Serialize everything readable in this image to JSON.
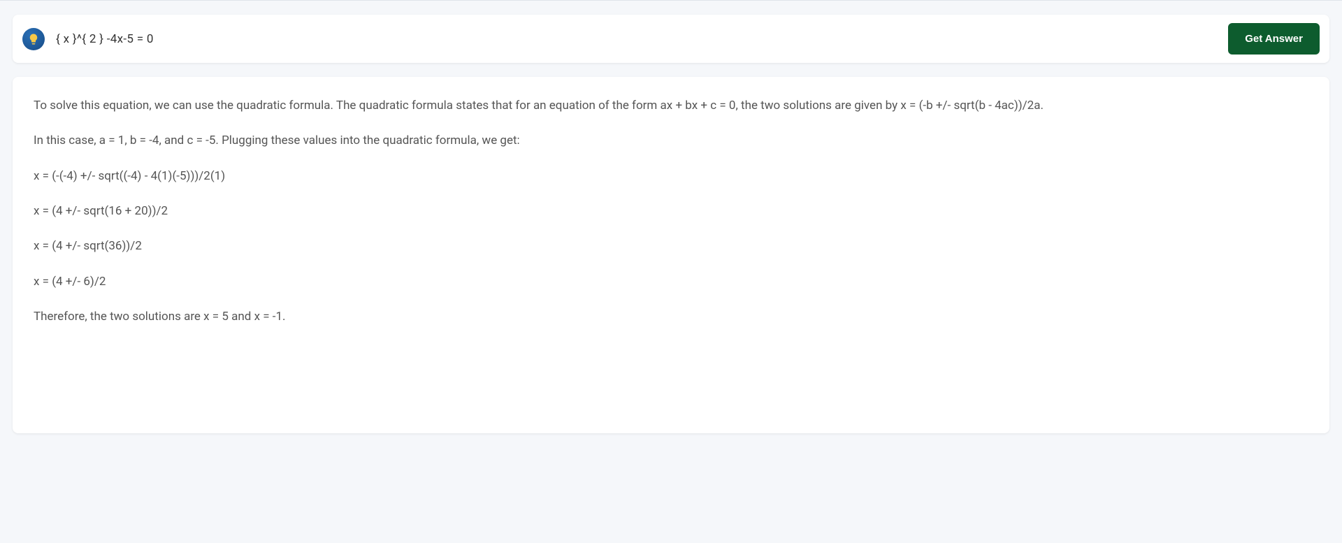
{
  "header": {
    "query": "{ x  }^{ 2  }  -4x-5 =  0",
    "button_label": "Get Answer"
  },
  "answer": {
    "lines": [
      "To solve this equation, we can use the quadratic formula. The quadratic formula states that for an equation of the form ax + bx + c = 0, the two solutions are given by x = (-b +/- sqrt(b - 4ac))/2a.",
      "In this case, a = 1, b = -4, and c = -5. Plugging these values into the quadratic formula, we get:",
      "x = (-(-4) +/- sqrt((-4) - 4(1)(-5)))/2(1)",
      "x = (4 +/- sqrt(16 + 20))/2",
      "x = (4 +/- sqrt(36))/2",
      "x = (4 +/- 6)/2",
      "Therefore, the two solutions are x = 5 and x = -1."
    ]
  }
}
